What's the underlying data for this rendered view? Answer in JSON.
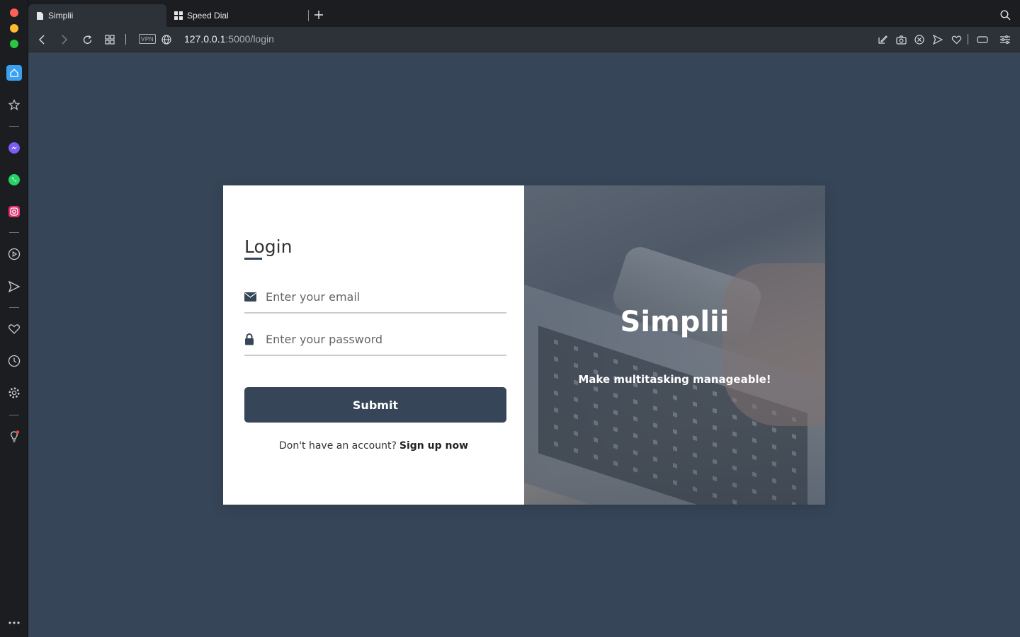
{
  "browser": {
    "tabs": [
      {
        "label": "Simplii",
        "icon": "document-icon",
        "active": true
      },
      {
        "label": "Speed Dial",
        "icon": "grid-icon",
        "active": false
      }
    ],
    "address": {
      "host": "127.0.0.1",
      "path": ":5000/login",
      "vpn_label": "VPN"
    }
  },
  "sidebar": {
    "items": [
      "home-icon",
      "bookmark-star-icon",
      "messenger-icon",
      "whatsapp-icon",
      "instagram-icon",
      "player-icon",
      "send-icon",
      "heart-icon",
      "history-icon",
      "settings-icon",
      "lightbulb-icon",
      "more-icon"
    ]
  },
  "login": {
    "title": "Login",
    "email_placeholder": "Enter your email",
    "password_placeholder": "Enter your password",
    "submit_label": "Submit",
    "signup_prompt": "Don't have an account?",
    "signup_link": "Sign up now"
  },
  "hero": {
    "brand": "Simplii",
    "tagline": "Make multitasking manageable!"
  },
  "colors": {
    "page_bg": "#364558",
    "button_bg": "#364558",
    "sidebar_bg": "#1b1d21"
  }
}
